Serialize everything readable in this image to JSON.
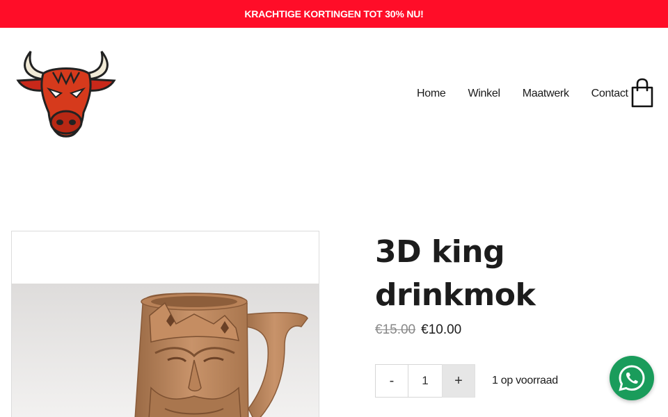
{
  "promo": {
    "text": "KRACHTIGE KORTINGEN TOT 30% NU!",
    "background": "#ff0d28"
  },
  "header": {
    "logo_icon": "bull-head-logo",
    "nav": [
      {
        "label": "Home"
      },
      {
        "label": "Winkel"
      },
      {
        "label": "Maatwerk"
      },
      {
        "label": "Contact"
      }
    ],
    "cart_icon": "shopping-bag-icon"
  },
  "product": {
    "title": "3D king drinkmok",
    "price_old": "€15.00",
    "price_new": "€10.00",
    "quantity": {
      "minus_label": "-",
      "value": "1",
      "plus_label": "+"
    },
    "stock": "1 op voorraad"
  },
  "gallery": {
    "image_icon": "king-mug-photo"
  },
  "whatsapp": {
    "icon": "whatsapp-icon",
    "color": "#1a9c5b"
  }
}
